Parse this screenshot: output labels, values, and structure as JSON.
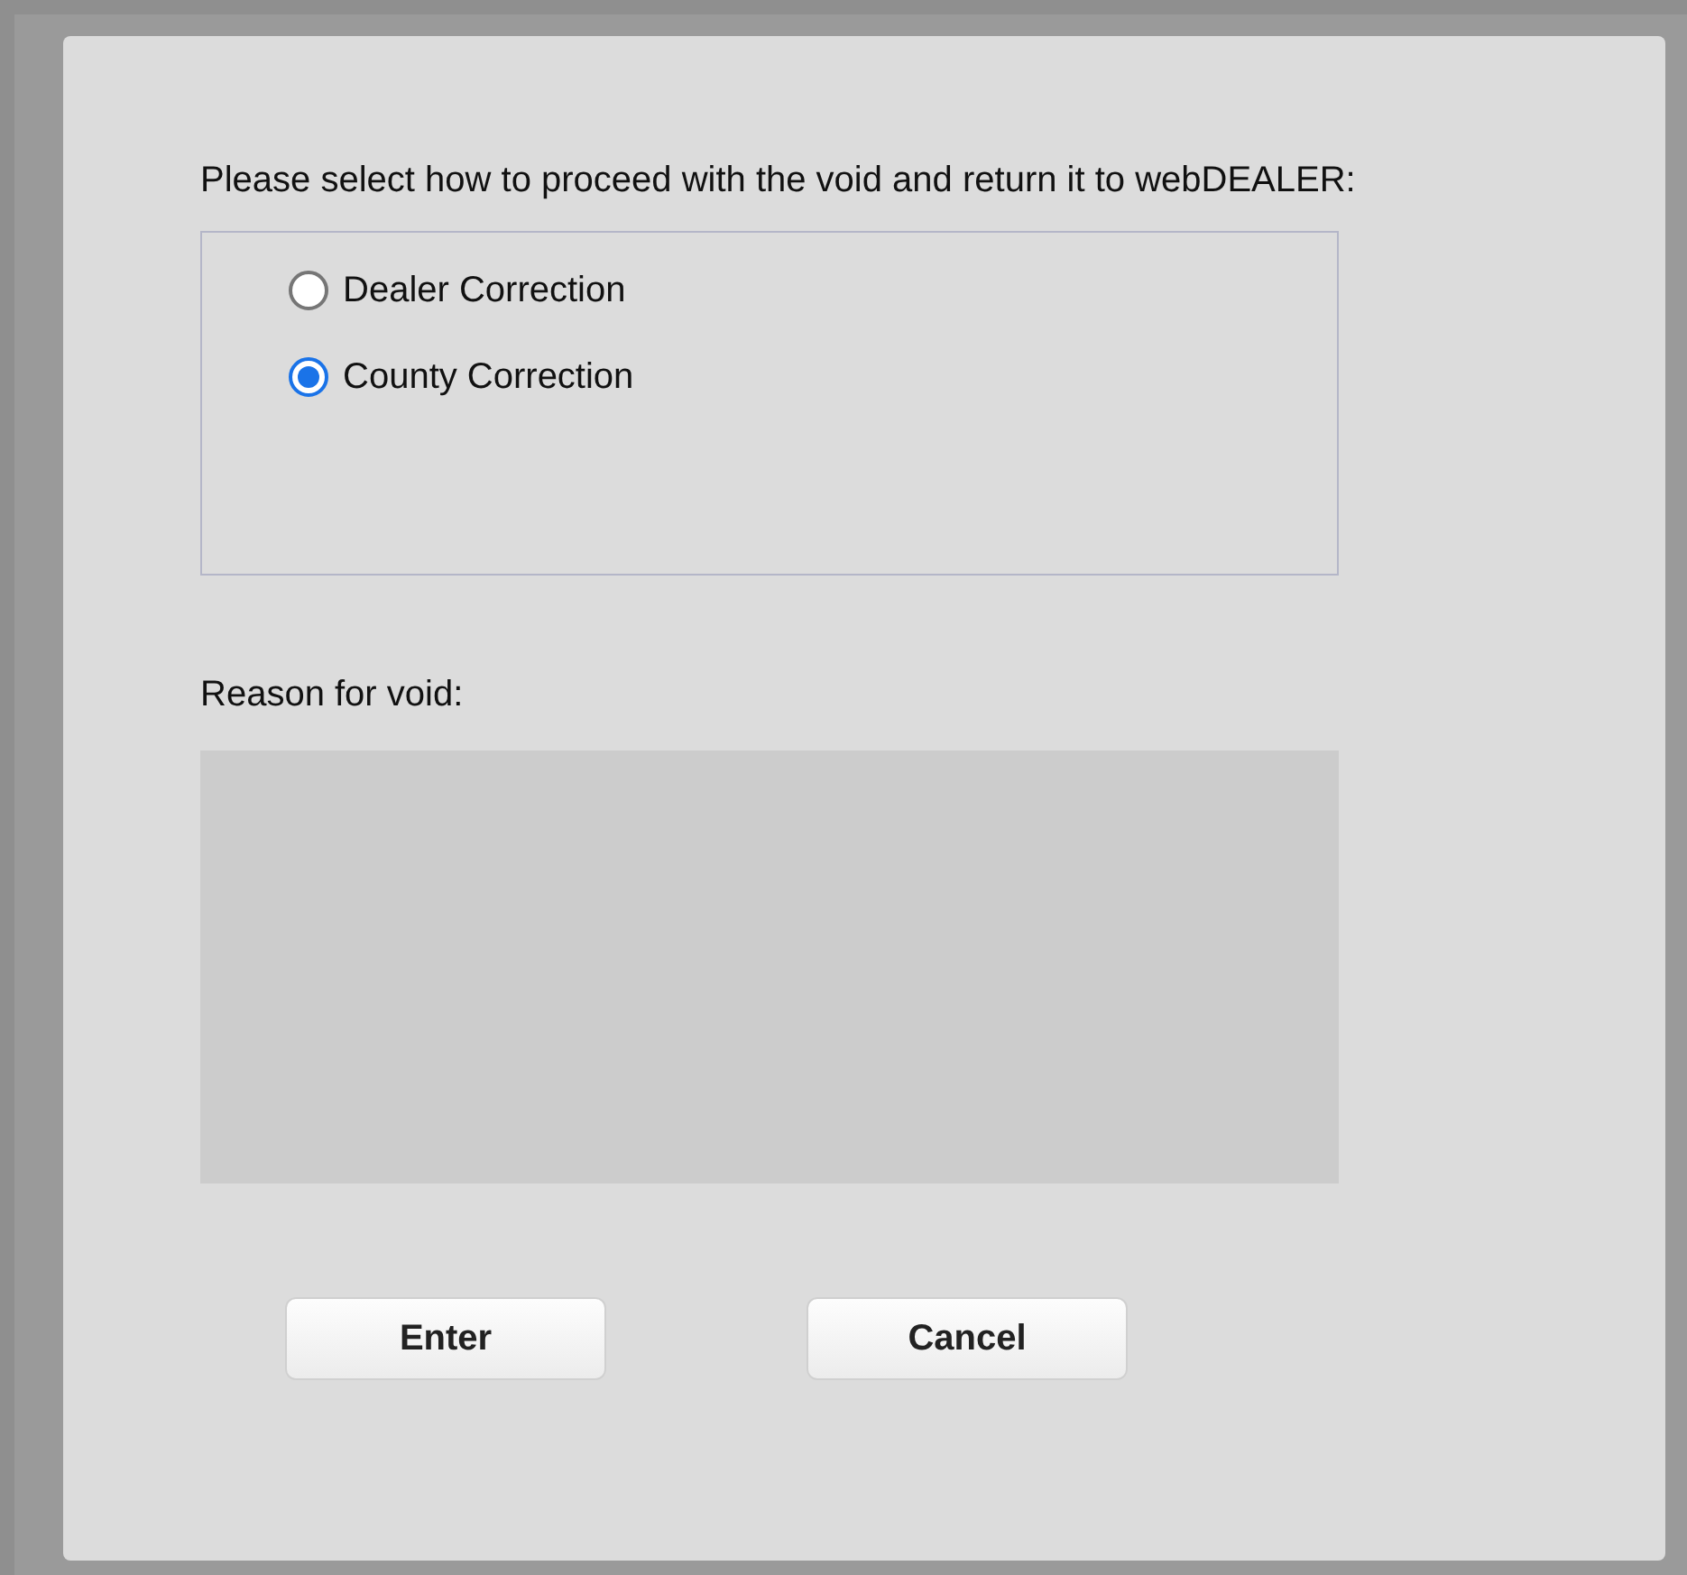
{
  "prompt": "Please select how to proceed with the void and return it to webDEALER:",
  "options": [
    {
      "label": "Dealer Correction",
      "selected": false
    },
    {
      "label": "County Correction",
      "selected": true
    }
  ],
  "reason": {
    "label": "Reason for void:"
  },
  "buttons": [
    "Enter",
    "Cancel"
  ]
}
